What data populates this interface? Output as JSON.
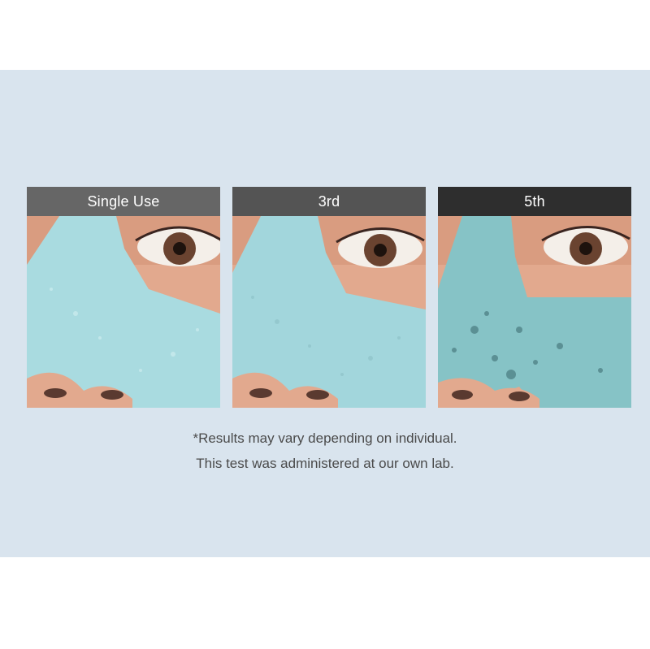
{
  "panels": [
    {
      "label": "Single Use",
      "header_color": "#666666"
    },
    {
      "label": "3rd",
      "header_color": "#545454"
    },
    {
      "label": "5th",
      "header_color": "#2e2e2e"
    }
  ],
  "disclaimer": {
    "line1": "*Results may vary depending on individual.",
    "line2": "This test was administered at our own lab."
  },
  "colors": {
    "band": "#d9e4ee",
    "skin": "#e2a98e",
    "mask_light": "#a9dbe0",
    "mask_dark": "#6fa6ac"
  }
}
